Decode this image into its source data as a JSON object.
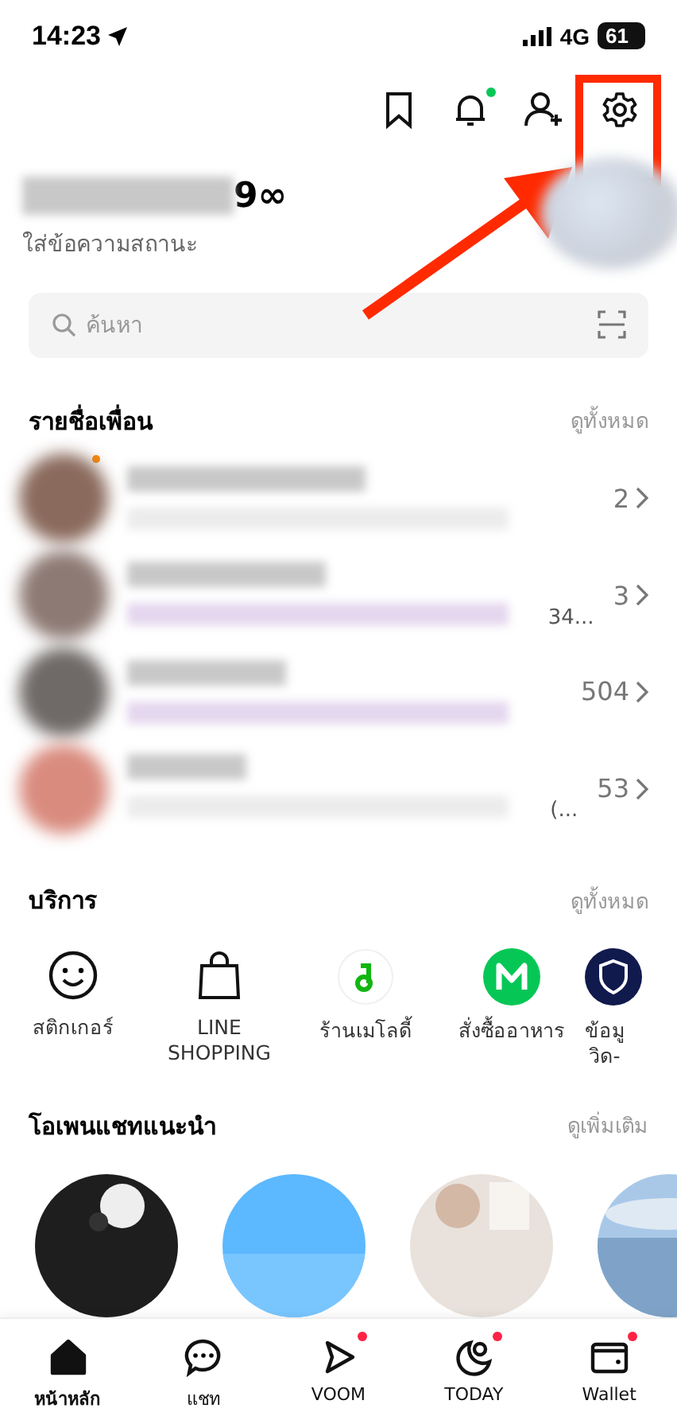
{
  "status_bar": {
    "time": "14:23",
    "network": "4G",
    "battery": "61"
  },
  "header": {
    "settings_highlighted": true,
    "notification_dot": true
  },
  "profile": {
    "name_visible_part": "9∞",
    "status_placeholder": "ใส่ข้อความสถานะ"
  },
  "search": {
    "placeholder": "ค้นหา"
  },
  "friends": {
    "title": "รายชื่อเพื่อน",
    "see_all": "ดูทั้งหมด",
    "rows": [
      {
        "count": "2",
        "snippet_end": "",
        "has_update": true
      },
      {
        "count": "3",
        "snippet_end": "34...",
        "has_update": false
      },
      {
        "count": "504",
        "snippet_end": "",
        "has_update": false
      },
      {
        "count": "53",
        "snippet_end": "(...",
        "has_update": false
      }
    ]
  },
  "services": {
    "title": "บริการ",
    "see_all": "ดูทั้งหมด",
    "items": [
      {
        "kind": "smiley",
        "lines": [
          "สติกเกอร์"
        ]
      },
      {
        "kind": "bag",
        "lines": [
          "LINE",
          "SHOPPING"
        ]
      },
      {
        "kind": "melody",
        "lines": [
          "ร้านเมโลดี้"
        ]
      },
      {
        "kind": "food",
        "lines": [
          "สั่งซื้ออาหาร"
        ]
      },
      {
        "kind": "shield",
        "lines": [
          "ข้อมู",
          "วิด-"
        ]
      }
    ]
  },
  "open_chats": {
    "title": "โอเพนแชทแนะนำ",
    "see_more": "ดูเพิ่มเติม"
  },
  "tab_bar": [
    {
      "kind": "home",
      "label": "หน้าหลัก",
      "selected": true,
      "badge": false
    },
    {
      "kind": "chat",
      "label": "แชท",
      "selected": false,
      "badge": false
    },
    {
      "kind": "voom",
      "label": "VOOM",
      "selected": false,
      "badge": true
    },
    {
      "kind": "today",
      "label": "TODAY",
      "selected": false,
      "badge": true
    },
    {
      "kind": "wallet",
      "label": "Wallet",
      "selected": false,
      "badge": true
    }
  ]
}
